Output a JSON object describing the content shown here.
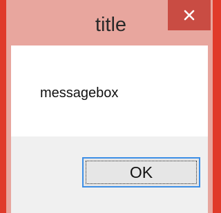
{
  "window": {
    "title": "title",
    "close_icon": "close-icon"
  },
  "message": {
    "text": "messagebox"
  },
  "buttons": {
    "ok_label": "OK"
  },
  "colors": {
    "background_accent": "#e03a2a",
    "frame": "#e8a69e",
    "close_button": "#c94c43",
    "ok_border": "#3c8ee6"
  }
}
